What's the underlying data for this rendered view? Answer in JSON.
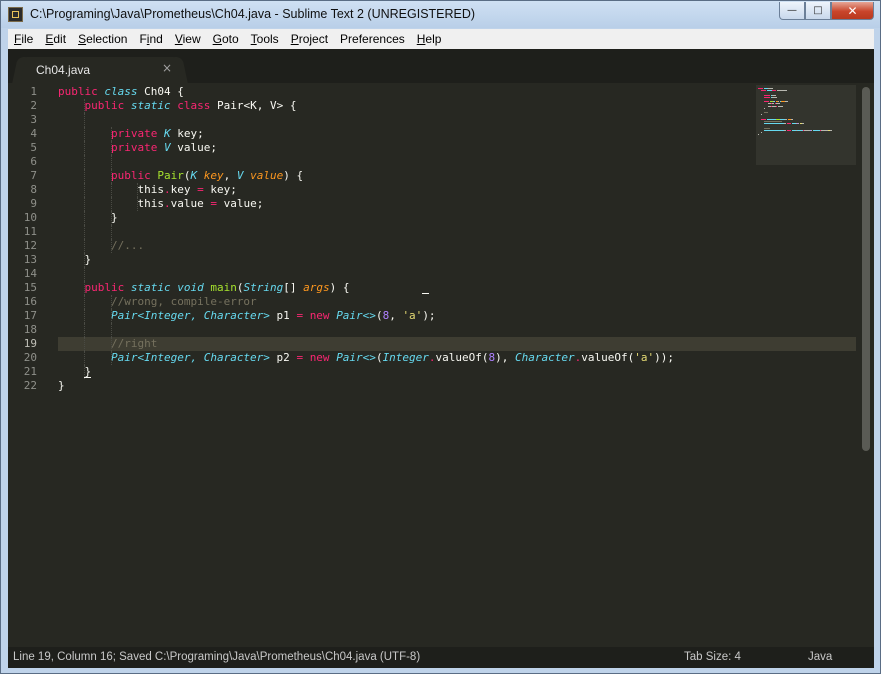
{
  "window": {
    "title": "C:\\Programing\\Java\\Prometheus\\Ch04.java - Sublime Text 2 (UNREGISTERED)",
    "controls": {
      "minimize": "—",
      "maximize": "□",
      "close": "✕"
    }
  },
  "menu": [
    {
      "key": "F",
      "rest": "ile"
    },
    {
      "key": "E",
      "rest": "dit"
    },
    {
      "key": "S",
      "rest": "election"
    },
    {
      "key": "F",
      "rest": "ind",
      "pre": ""
    },
    {
      "key": "V",
      "rest": "iew"
    },
    {
      "key": "G",
      "rest": "oto"
    },
    {
      "key": "T",
      "rest": "ools"
    },
    {
      "key": "P",
      "rest": "roject"
    },
    {
      "key": "",
      "rest": "Preferences",
      "pre": ""
    },
    {
      "key": "H",
      "rest": "elp"
    }
  ],
  "menu_labels": [
    "File",
    "Edit",
    "Selection",
    "Find",
    "View",
    "Goto",
    "Tools",
    "Project",
    "Preferences",
    "Help"
  ],
  "tab": {
    "label": "Ch04.java",
    "close": "×"
  },
  "editor": {
    "active_line": 19,
    "lines": [
      [
        [
          "kw",
          "public "
        ],
        [
          "st",
          "class "
        ],
        [
          "",
          "Ch04 {"
        ]
      ],
      [
        [
          "",
          "    "
        ],
        [
          "kw",
          "public "
        ],
        [
          "st",
          "static "
        ],
        [
          "kw",
          "class "
        ],
        [
          "",
          "Pair<K, V> {"
        ]
      ],
      [],
      [
        [
          "",
          "        "
        ],
        [
          "kw",
          "private "
        ],
        [
          "ty",
          "K"
        ],
        [
          "",
          " key;"
        ]
      ],
      [
        [
          "",
          "        "
        ],
        [
          "kw",
          "private "
        ],
        [
          "ty",
          "V"
        ],
        [
          "",
          " value;"
        ]
      ],
      [],
      [
        [
          "",
          "        "
        ],
        [
          "kw",
          "public "
        ],
        [
          "fn",
          "Pair"
        ],
        [
          "",
          "("
        ],
        [
          "ty",
          "K "
        ],
        [
          "pa",
          "key"
        ],
        [
          "",
          ", "
        ],
        [
          "ty",
          "V "
        ],
        [
          "pa",
          "value"
        ],
        [
          "",
          ") {"
        ]
      ],
      [
        [
          "",
          "            this"
        ],
        [
          "kw",
          "."
        ],
        [
          "",
          "key "
        ],
        [
          "kw",
          "="
        ],
        [
          "",
          " key;"
        ]
      ],
      [
        [
          "",
          "            this"
        ],
        [
          "kw",
          "."
        ],
        [
          "",
          "value "
        ],
        [
          "kw",
          "="
        ],
        [
          "",
          " value;"
        ]
      ],
      [
        [
          "",
          "        }"
        ]
      ],
      [],
      [
        [
          "",
          "        "
        ],
        [
          "cm",
          "//..."
        ]
      ],
      [
        [
          "",
          "    }"
        ]
      ],
      [],
      [
        [
          "",
          "    "
        ],
        [
          "kw",
          "public "
        ],
        [
          "st",
          "static "
        ],
        [
          "st",
          "void "
        ],
        [
          "fn",
          "main"
        ],
        [
          "",
          "("
        ],
        [
          "ty",
          "String"
        ],
        [
          "",
          "[] "
        ],
        [
          "pa",
          "args"
        ],
        [
          "",
          ") {"
        ]
      ],
      [
        [
          "",
          "        "
        ],
        [
          "cm",
          "//wrong, compile-error"
        ]
      ],
      [
        [
          "",
          "        "
        ],
        [
          "ty",
          "Pair<Integer, Character>"
        ],
        [
          "",
          " p1 "
        ],
        [
          "kw",
          "="
        ],
        [
          "",
          " "
        ],
        [
          "kw",
          "new "
        ],
        [
          "ty",
          "Pair<>"
        ],
        [
          "",
          "("
        ],
        [
          "num",
          "8"
        ],
        [
          "",
          ", "
        ],
        [
          "str",
          "'a'"
        ],
        [
          "",
          ");"
        ]
      ],
      [],
      [
        [
          "",
          "        "
        ],
        [
          "cm",
          "//right"
        ]
      ],
      [
        [
          "",
          "        "
        ],
        [
          "ty",
          "Pair<Integer, Character>"
        ],
        [
          "",
          " p2 "
        ],
        [
          "kw",
          "="
        ],
        [
          "",
          " "
        ],
        [
          "kw",
          "new "
        ],
        [
          "ty",
          "Pair<>"
        ],
        [
          "",
          "("
        ],
        [
          "ty",
          "Integer"
        ],
        [
          "kw",
          "."
        ],
        [
          "",
          "valueOf("
        ],
        [
          "num",
          "8"
        ],
        [
          "",
          "), "
        ],
        [
          "ty",
          "Character"
        ],
        [
          "kw",
          "."
        ],
        [
          "",
          "valueOf("
        ],
        [
          "str",
          "'a'"
        ],
        [
          "",
          "));"
        ]
      ],
      [
        [
          "",
          "    }"
        ]
      ],
      [
        [
          "",
          "}"
        ]
      ]
    ]
  },
  "status": {
    "left": "Line 19, Column 16; Saved C:\\Programing\\Java\\Prometheus\\Ch04.java (UTF-8)",
    "tab_size": "Tab Size: 4",
    "syntax": "Java"
  },
  "colors": {
    "background": "#272822",
    "keyword": "#f92672",
    "type": "#66d9ef",
    "function": "#a6e22e",
    "parameter": "#fd971f",
    "comment": "#75715e",
    "number": "#ae81ff",
    "string": "#e6db74",
    "text": "#f8f8f2"
  }
}
